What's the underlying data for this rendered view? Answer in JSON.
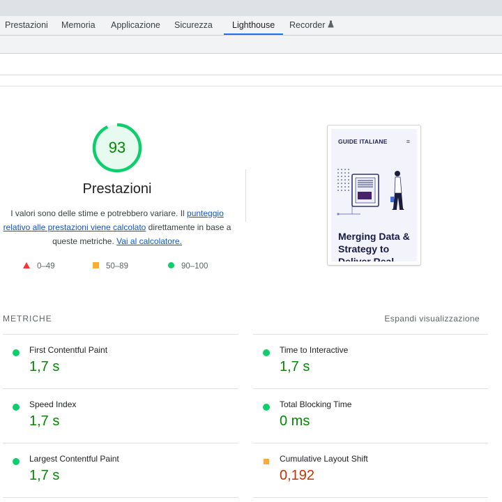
{
  "tabs": [
    {
      "label": "Prestazioni"
    },
    {
      "label": "Memoria"
    },
    {
      "label": "Applicazione"
    },
    {
      "label": "Sicurezza"
    },
    {
      "label": "Lighthouse",
      "active": true
    },
    {
      "label": "Recorder",
      "icon": "flask-icon"
    }
  ],
  "gauge": {
    "score": "93",
    "title": "Prestazioni",
    "description_pre": "I valori sono delle stime e potrebbero variare. Il ",
    "description_link": "punteggio relativo alle prestazioni viene calcolato",
    "description_mid": " direttamente in base a queste metriche. ",
    "calc_link": "Vai al calcolatore."
  },
  "legend": [
    {
      "label": "0–49",
      "icon": "fail-triangle-icon",
      "color": "#ff3333"
    },
    {
      "label": "50–89",
      "icon": "average-square-icon",
      "color": "#ffaa33"
    },
    {
      "label": "90–100",
      "icon": "pass-circle-icon",
      "color": "#0cce6b"
    }
  ],
  "screenshot": {
    "brand": "GUIDE ITALIANE",
    "menu_icon": "hamburger-menu-icon",
    "headline": "Merging Data & Strategy to Deliver Real"
  },
  "metrics": {
    "section_title": "METRICHE",
    "expand_label": "Espandi visualizzazione",
    "items": [
      {
        "title": "First Contentful Paint",
        "value": "1,7 s",
        "rating": "pass"
      },
      {
        "title": "Time to Interactive",
        "value": "1,7 s",
        "rating": "pass"
      },
      {
        "title": "Speed Index",
        "value": "1,7 s",
        "rating": "pass"
      },
      {
        "title": "Total Blocking Time",
        "value": "0 ms",
        "rating": "pass"
      },
      {
        "title": "Largest Contentful Paint",
        "value": "1,7 s",
        "rating": "pass"
      },
      {
        "title": "Cumulative Layout Shift",
        "value": "0,192",
        "rating": "average"
      }
    ]
  },
  "colors": {
    "pass": "#0cce6b",
    "pass_text": "#008800",
    "average": "#ffaa33",
    "average_text": "#c33300",
    "fail": "#ff3333",
    "accent": "#1a73e8",
    "link": "#1155cc"
  },
  "score_value": 0.93
}
